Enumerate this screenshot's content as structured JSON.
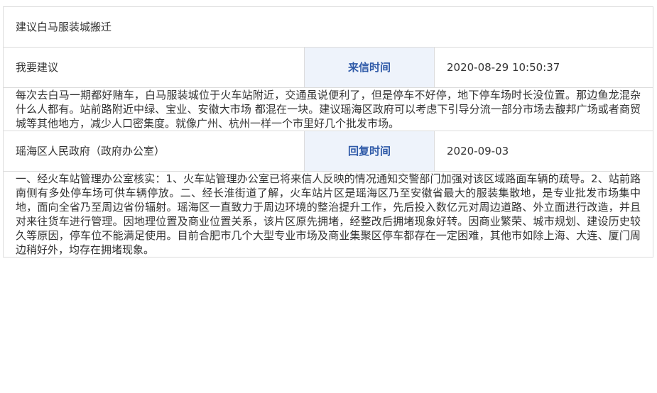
{
  "letter": {
    "title": "建议白马服装城搬迁",
    "submit": {
      "sender": "我要建议",
      "time_label": "来信时间",
      "time_value": "2020-08-29 10:50:37"
    },
    "content": "每次去白马一期都好赌车，白马服装城位于火车站附近，交通虽说便利了，但是停车不好停，地下停车场时长没位置。那边鱼龙混杂什么人都有。站前路附近中绿、宝业、安徽大市场 都混在一块。建议瑶海区政府可以考虑下引导分流一部分市场去馥邦广场或者商贸城等其他地方，减少人口密集度。就像广州、杭州一样一个市里好几个批发市场。",
    "reply": {
      "responder": "瑶海区人民政府（政府办公室）",
      "time_label": "回复时间",
      "time_value": "2020-09-03"
    },
    "reply_content": "一、经火车站管理办公室核实：1、火车站管理办公室已将来信人反映的情况通知交警部门加强对该区域路面车辆的疏导。2、站前路南侧有多处停车场可供车辆停放。二、经长淮街道了解，火车站片区是瑶海区乃至安徽省最大的服装集散地，是专业批发市场集中地，面向全省乃至周边省份辐射。瑶海区一直致力于周边环境的整治提升工作，先后投入数亿元对周边道路、外立面进行改造，并且对来往货车进行管理。因地理位置及商业位置关系，该片区原先拥堵，经整改后拥堵现象好转。因商业繁荣、城市规划、建设历史较久等原因，停车位不能满足使用。目前合肥市几个大型专业市场及商业集聚区停车都存在一定困难，其他市如除上海、大连、厦门周边稍好外，均存在拥堵现象。"
  }
}
